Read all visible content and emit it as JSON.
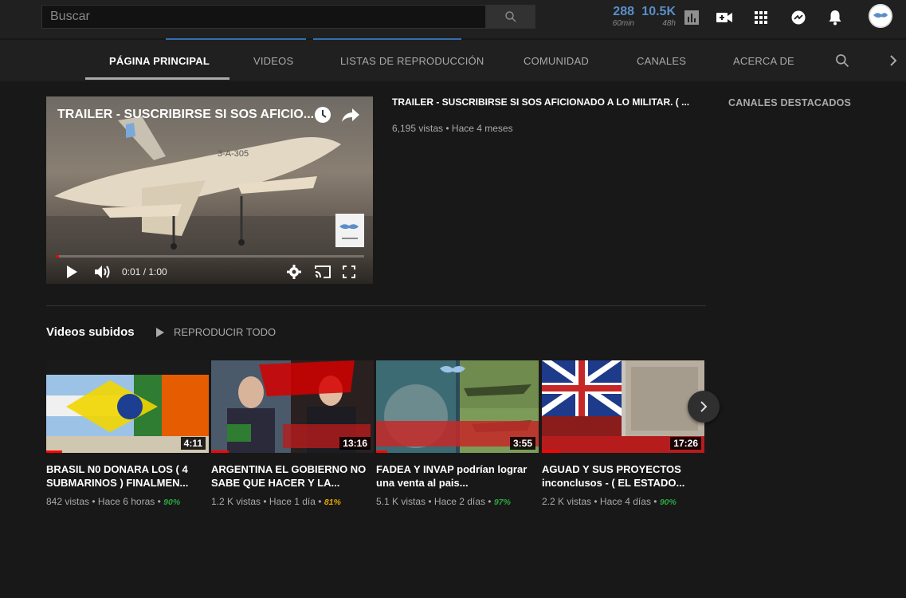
{
  "search": {
    "placeholder": "Buscar"
  },
  "stats": [
    {
      "value": "288",
      "label": "60min"
    },
    {
      "value": "10.5K",
      "label": "48h"
    }
  ],
  "tabs": [
    {
      "label": "PÁGINA PRINCIPAL"
    },
    {
      "label": "VIDEOS"
    },
    {
      "label": "LISTAS DE REPRODUCCIÓN"
    },
    {
      "label": "COMUNIDAD"
    },
    {
      "label": "CANALES"
    },
    {
      "label": "ACERCA DE"
    }
  ],
  "featured": {
    "overlay_title": "TRAILER - SUSCRIBIRSE SI SOS AFICIO...",
    "title": "TRAILER - SUSCRIBIRSE SI SOS AFICIONADO A LO MILITAR. ( ...",
    "meta": "6,195 vistas • Hace 4 meses",
    "time": "0:01 / 1:00",
    "progress": 0.01,
    "jet_label": "3-A-305"
  },
  "sidebar": {
    "title": "CANALES DESTACADOS"
  },
  "uploads": {
    "title": "Videos subidos",
    "play_all": "REPRODUCIR TODO",
    "videos": [
      {
        "title": "BRASIL N0 DONARA LOS ( 4 SUBMARINOS ) FINALMEN...",
        "views": "842 vistas",
        "age": "Hace 6 horas",
        "pct": "90%",
        "pct_color": "#2ba640",
        "duration": "4:11"
      },
      {
        "title": "ARGENTINA EL GOBIERNO NO SABE QUE HACER Y LA...",
        "views": "1.2 K vistas",
        "age": "Hace 1 día",
        "pct": "81%",
        "pct_color": "#e0a500",
        "duration": "13:16"
      },
      {
        "title": "FADEA Y INVAP podrían lograr una venta al pais...",
        "views": "5.1 K vistas",
        "age": "Hace 2 días",
        "pct": "97%",
        "pct_color": "#2ba640",
        "duration": "3:55"
      },
      {
        "title": "AGUAD Y SUS PROYECTOS inconclusos - ( EL ESTADO...",
        "views": "2.2 K vistas",
        "age": "Hace 4 días",
        "pct": "90%",
        "pct_color": "#2ba640",
        "duration": "17:26"
      }
    ]
  },
  "colors": {
    "accent_blue": "#5a8ec9",
    "red": "#ff0000",
    "green": "#2ba640",
    "amber": "#e0a500"
  }
}
